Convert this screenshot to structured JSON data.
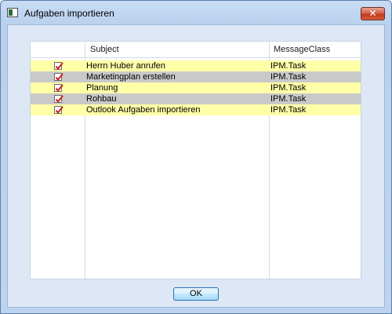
{
  "window": {
    "title": "Aufgaben importieren",
    "close_symbol": "✕",
    "icon": "window-app-icon"
  },
  "table": {
    "columns": [
      "",
      "Subject",
      "MessageClass"
    ],
    "rows": [
      {
        "checked": true,
        "subject": "Herrn Huber anrufen",
        "message_class": "IPM.Task"
      },
      {
        "checked": true,
        "subject": "Marketingplan erstellen",
        "message_class": "IPM.Task"
      },
      {
        "checked": true,
        "subject": "Planung",
        "message_class": "IPM.Task"
      },
      {
        "checked": true,
        "subject": "Rohbau",
        "message_class": "IPM.Task"
      },
      {
        "checked": true,
        "subject": "Outlook Aufgaben importieren",
        "message_class": "IPM.Task"
      }
    ]
  },
  "buttons": {
    "ok_label": "OK"
  },
  "colors": {
    "row_highlight": "#ffffa8",
    "row_alternate": "#c9c9c9",
    "check_mark": "#d0201a"
  }
}
